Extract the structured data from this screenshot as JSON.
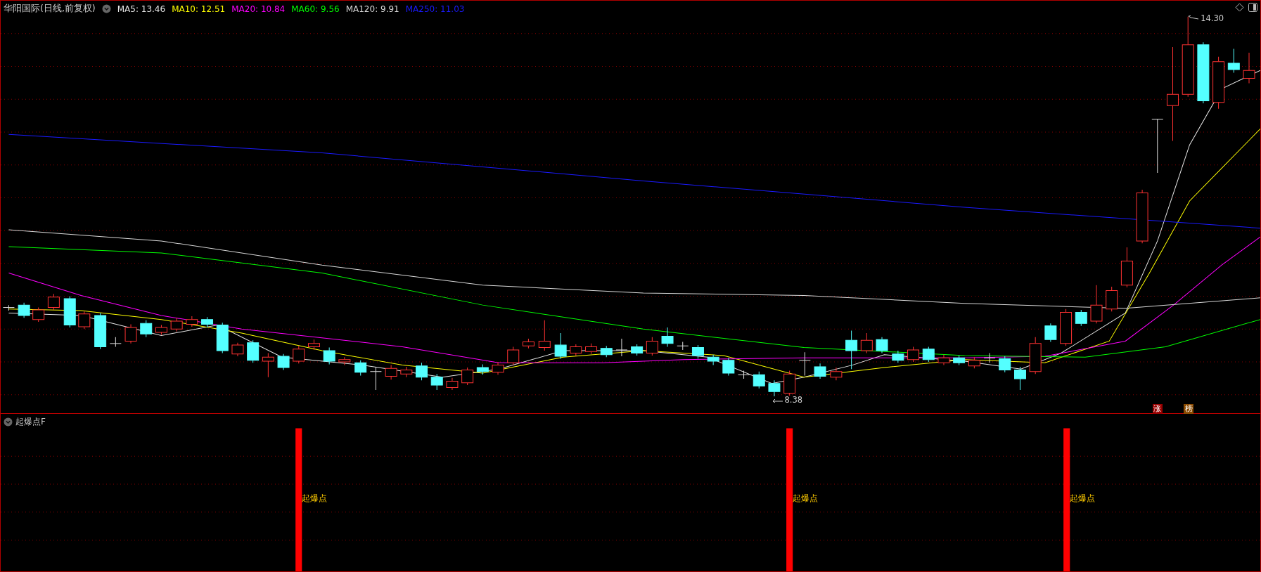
{
  "header": {
    "title": "华阳国际(日线,前复权)",
    "indicators": [
      {
        "label": "MA5: 13.46",
        "color": "#e6e6e6"
      },
      {
        "label": "MA10: 12.51",
        "color": "#ffff00"
      },
      {
        "label": "MA20: 10.84",
        "color": "#ff00ff"
      },
      {
        "label": "MA60: 9.56",
        "color": "#00ff00"
      },
      {
        "label": "MA120: 9.91",
        "color": "#d8d8d8"
      },
      {
        "label": "MA250: 11.03",
        "color": "#1a1aff"
      }
    ]
  },
  "main_chart": {
    "high_label": "14.30",
    "low_label": "8.38",
    "badges": [
      {
        "text": "涨",
        "color": "#990000"
      },
      {
        "text": "榜",
        "color": "#8a4a00"
      }
    ]
  },
  "sub_panel": {
    "title": "起爆点F",
    "signals": [
      {
        "label": "起爆点"
      },
      {
        "label": "起爆点"
      },
      {
        "label": "起爆点"
      }
    ]
  }
}
